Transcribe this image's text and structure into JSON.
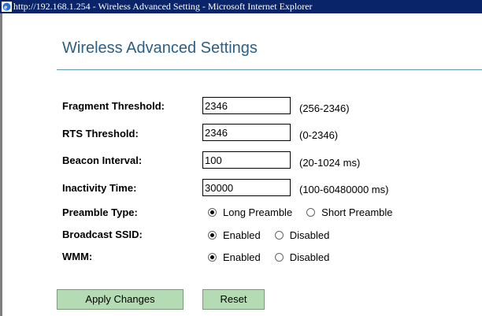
{
  "window": {
    "title": "http://192.168.1.254 - Wireless Advanced Setting - Microsoft Internet Explorer"
  },
  "page": {
    "title": "Wireless Advanced Settings"
  },
  "fields": {
    "fragment": {
      "label": "Fragment Threshold:",
      "value": "2346",
      "hint": "(256-2346)"
    },
    "rts": {
      "label": "RTS Threshold:",
      "value": "2346",
      "hint": "(0-2346)"
    },
    "beacon": {
      "label": "Beacon Interval:",
      "value": "100",
      "hint": "(20-1024 ms)"
    },
    "inactivity": {
      "label": "Inactivity Time:",
      "value": "30000",
      "hint": "(100-60480000 ms)"
    }
  },
  "radios": {
    "preamble": {
      "label": "Preamble Type:",
      "option1": "Long Preamble",
      "option2": "Short Preamble",
      "selected": "Long Preamble"
    },
    "ssid": {
      "label": "Broadcast SSID:",
      "option1": "Enabled",
      "option2": "Disabled",
      "selected": "Enabled"
    },
    "wmm": {
      "label": "WMM:",
      "option1": "Enabled",
      "option2": "Disabled",
      "selected": "Enabled"
    }
  },
  "buttons": {
    "apply": "Apply Changes",
    "reset": "Reset"
  },
  "colors": {
    "titlebar": "#0a246a",
    "heading": "#2c5f86",
    "button": "#b4dbb4"
  },
  "icons": {
    "browser": "internet-explorer-icon"
  }
}
